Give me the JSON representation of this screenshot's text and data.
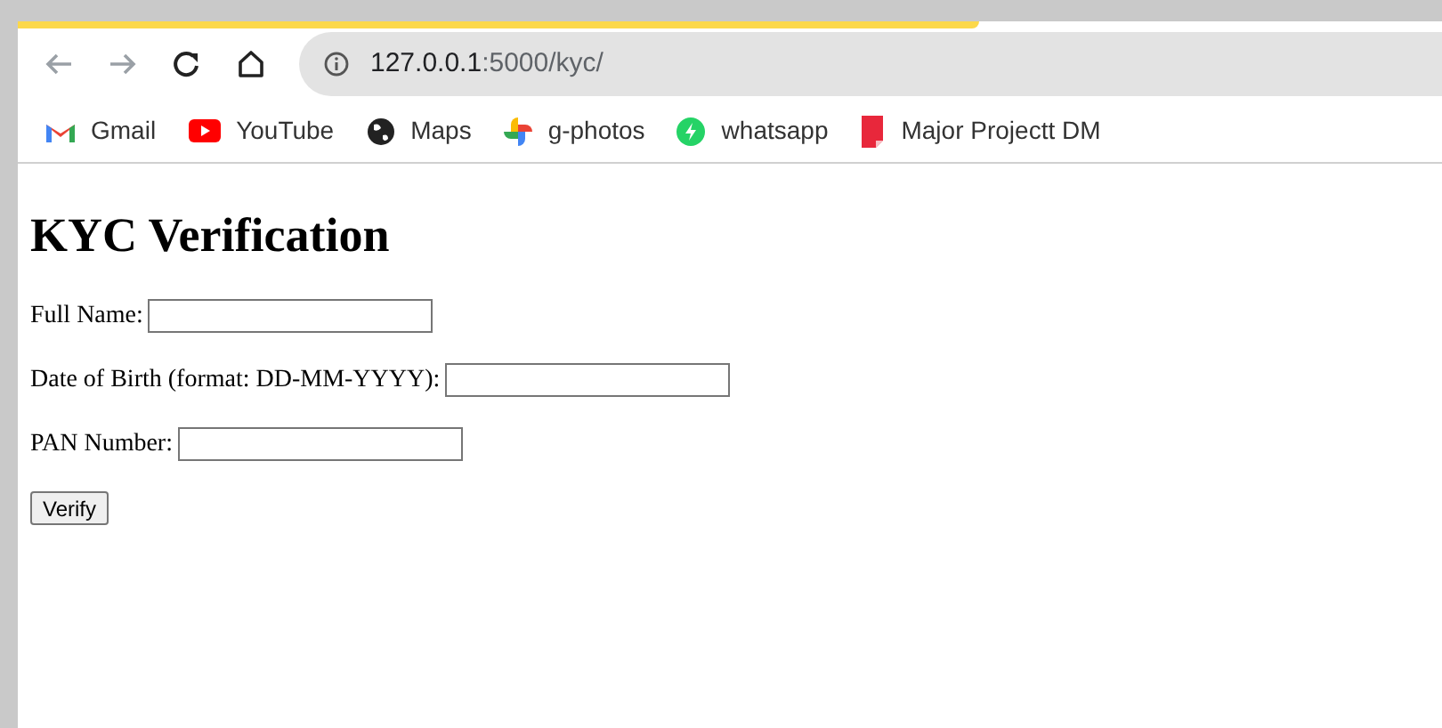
{
  "browser": {
    "url_host": "127.0.0.1",
    "url_path": ":5000/kyc/",
    "bookmarks": [
      {
        "label": "Gmail",
        "kind": "gmail"
      },
      {
        "label": "YouTube",
        "kind": "youtube"
      },
      {
        "label": "Maps",
        "kind": "globe"
      },
      {
        "label": "g-photos",
        "kind": "pinwheel"
      },
      {
        "label": "whatsapp",
        "kind": "chat"
      },
      {
        "label": "Major Projectt DM",
        "kind": "doc"
      }
    ]
  },
  "page": {
    "title": "KYC Verification",
    "fields": [
      {
        "label": "Full Name:"
      },
      {
        "label": "Date of Birth (format: DD-MM-YYYY):"
      },
      {
        "label": "PAN Number:"
      }
    ],
    "button": "Verify"
  }
}
